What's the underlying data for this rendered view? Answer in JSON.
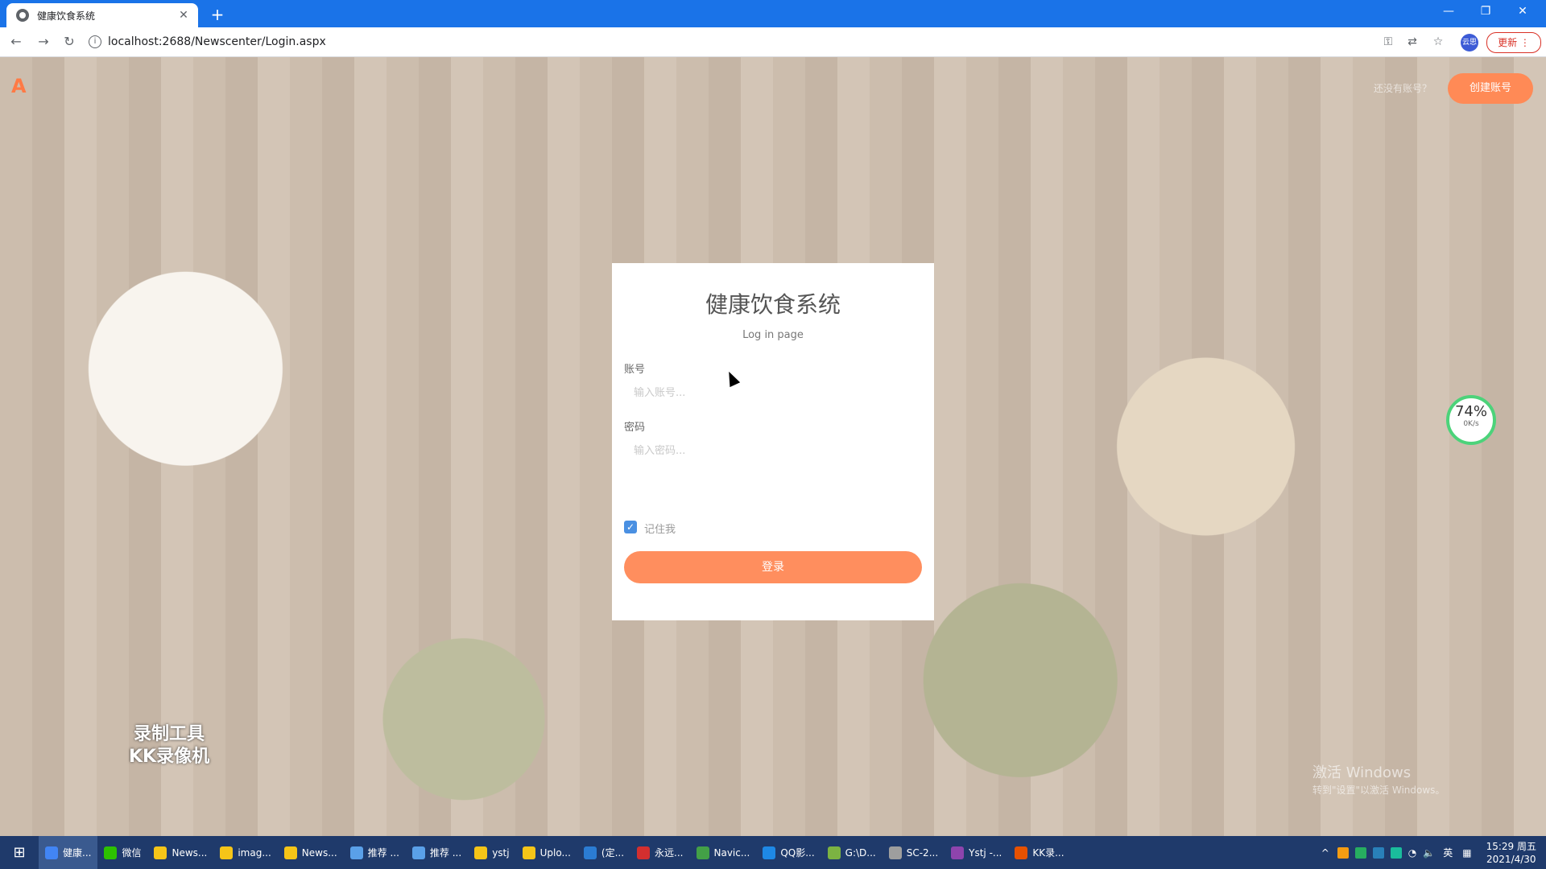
{
  "browser": {
    "tab_title": "健康饮食系统",
    "url": "localhost:2688/Newscenter/Login.aspx",
    "update_label": "更新",
    "profile_label": "云思"
  },
  "header": {
    "logo": "A",
    "signup_hint": "还没有账号？",
    "create_account": "创建账号"
  },
  "login": {
    "title": "健康饮食系统",
    "subtitle": "Log in page",
    "account_label": "账号",
    "account_placeholder": "输入账号...",
    "password_label": "密码",
    "password_placeholder": "输入密码...",
    "remember_label": "记住我",
    "remember_checked": true,
    "submit_label": "登录"
  },
  "overlay": {
    "gauge_percent": "74%",
    "gauge_speed": "0K/s",
    "watermark_line1": "录制工具",
    "watermark_line2": "KK录像机",
    "activate_title": "激活 Windows",
    "activate_sub": "转到\"设置\"以激活 Windows。"
  },
  "taskbar": {
    "items": [
      {
        "label": "健康...",
        "color": "#4285f4",
        "active": true
      },
      {
        "label": "微信",
        "color": "#2dc100"
      },
      {
        "label": "News...",
        "color": "#f5c518"
      },
      {
        "label": "imag...",
        "color": "#f5c518"
      },
      {
        "label": "News...",
        "color": "#f5c518"
      },
      {
        "label": "推荐 ...",
        "color": "#5aa0e8"
      },
      {
        "label": "推荐 ...",
        "color": "#5aa0e8"
      },
      {
        "label": "ystj",
        "color": "#f5c518"
      },
      {
        "label": "Uplo...",
        "color": "#f5c518"
      },
      {
        "label": "(定...",
        "color": "#2b7cd3"
      },
      {
        "label": "永远...",
        "color": "#d32f2f"
      },
      {
        "label": "Navic...",
        "color": "#43a047"
      },
      {
        "label": "QQ影...",
        "color": "#1e88e5"
      },
      {
        "label": "G:\\D...",
        "color": "#7cb342"
      },
      {
        "label": "SC-2...",
        "color": "#9e9e9e"
      },
      {
        "label": "Ystj -...",
        "color": "#8e44ad"
      },
      {
        "label": "KK录...",
        "color": "#e65100"
      }
    ],
    "ime": "英",
    "time": "15:29 周五",
    "date": "2021/4/30"
  }
}
